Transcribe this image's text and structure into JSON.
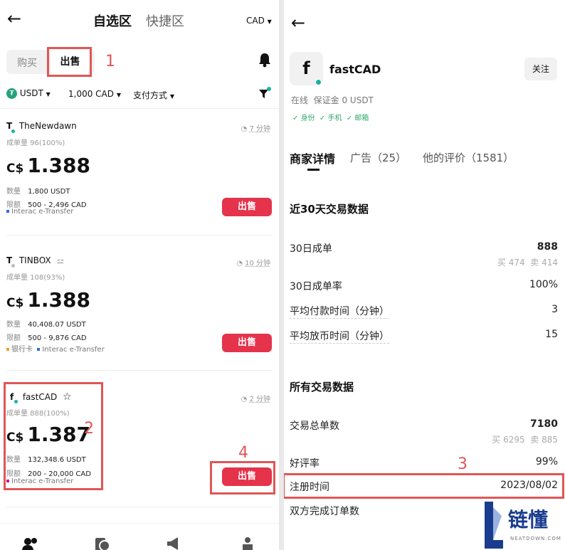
{
  "left": {
    "tabs": {
      "active": "自选区",
      "other": "快捷区"
    },
    "currency": "CAD",
    "buy_label": "购买",
    "sell_label": "出售",
    "filters": {
      "coin": "USDT",
      "amount": "1,000 CAD",
      "payment": "支付方式"
    },
    "ads": [
      {
        "name": "TheNewdawn",
        "initial": "T",
        "badge": "",
        "time": "7 分钟",
        "stats": "成单量 96(100%)",
        "currency_sign": "C$",
        "price": "1.388",
        "qty_label": "数量",
        "qty": "1,800 USDT",
        "limit_label": "限额",
        "limit": "500 - 2,496 CAD",
        "payments": [
          "Interac e-Transfer"
        ],
        "action": "出售"
      },
      {
        "name": "TINBOX",
        "initial": "T",
        "badge": "⚍",
        "time": "10 分钟",
        "stats": "成单量 108(93%)",
        "currency_sign": "C$",
        "price": "1.388",
        "qty_label": "数量",
        "qty": "40,408.07 USDT",
        "limit_label": "限额",
        "limit": "500 - 9,876 CAD",
        "payments": [
          "银行卡",
          "Interac e-Transfer"
        ],
        "action": "出售"
      },
      {
        "name": "fastCAD",
        "initial": "f",
        "badge": "☆",
        "time": "2 分钟",
        "stats": "成单量 888(100%)",
        "currency_sign": "C$",
        "price": "1.387",
        "qty_label": "数量",
        "qty": "132,348.6 USDT",
        "limit_label": "限额",
        "limit": "200 - 20,000 CAD",
        "payments": [
          "Interac e-Transfer"
        ],
        "action": "出售"
      }
    ],
    "annotations": [
      "1",
      "2",
      "4"
    ],
    "colors": {
      "accent": "#e5334b",
      "annotation": "#e05656",
      "online": "#17b3a3"
    }
  },
  "right": {
    "merchant": {
      "initial": "f",
      "name": "fastCAD",
      "follow": "关注",
      "status": "在线",
      "deposit": "保证金 0 USDT",
      "verifications": [
        "身份",
        "手机",
        "邮箱"
      ]
    },
    "tabs": [
      "商家详情",
      "广告（25）",
      "他的评价（1581）"
    ],
    "section30": {
      "title": "近30天交易数据",
      "rows": [
        {
          "label": "30日成单",
          "value": "888",
          "sub_buy": "买 474",
          "sub_sell": "卖 414"
        },
        {
          "label": "30日成单率",
          "value": "100%"
        },
        {
          "label": "平均付款时间（分钟）",
          "value": "3"
        },
        {
          "label": "平均放币时间（分钟）",
          "value": "15"
        }
      ]
    },
    "sectionAll": {
      "title": "所有交易数据",
      "rows": [
        {
          "label": "交易总单数",
          "value": "7180",
          "sub_buy": "买 6295",
          "sub_sell": "卖 885"
        },
        {
          "label": "好评率",
          "value": "99%"
        },
        {
          "label": "注册时间",
          "value": "2023/08/02"
        },
        {
          "label": "双方完成订单数",
          "value": ""
        }
      ]
    },
    "annotation": "3",
    "watermark": {
      "cn": "链懂",
      "en": "NEATDOWN.COM"
    }
  }
}
